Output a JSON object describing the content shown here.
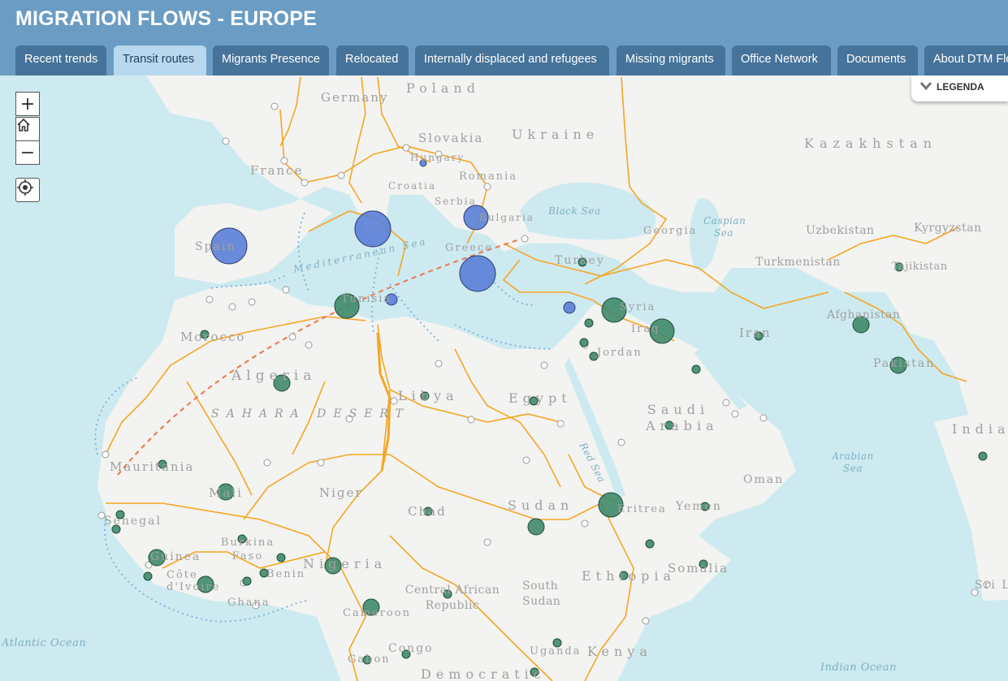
{
  "header": {
    "title": "MIGRATION FLOWS - EUROPE"
  },
  "tabs": [
    {
      "label": "Recent trends",
      "active": false
    },
    {
      "label": "Transit routes",
      "active": true
    },
    {
      "label": "Migrants Presence",
      "active": false
    },
    {
      "label": "Relocated",
      "active": false
    },
    {
      "label": "Internally displaced and refugees",
      "active": false
    },
    {
      "label": "Missing migrants",
      "active": false
    },
    {
      "label": "Office Network",
      "active": false
    },
    {
      "label": "Documents",
      "active": false
    },
    {
      "label": "About DTM Flow Monitoring",
      "active": false
    }
  ],
  "controls": {
    "zoom_in": "+",
    "zoom_out": "−",
    "home_icon": "home-icon",
    "locate_icon": "locate-icon"
  },
  "legend": {
    "label": "LEGENDA",
    "icon": "chevron-down-icon"
  },
  "colors": {
    "header": "#6a9cc4",
    "tab": "#46739a",
    "tab_active": "#b7d8ee",
    "route": "#f5a623",
    "route_dashed": "#e8805a",
    "sea_route": "#7cb2e0",
    "circle_blue": "#5b7fd6",
    "circle_green": "#3f8a6a",
    "water": "#cdeaf0",
    "land": "#f3f3f1"
  },
  "labels": {
    "countries": [
      "Poland",
      "Germany",
      "Slovakia",
      "Ukraine",
      "Kazakhstan",
      "France",
      "Hungary",
      "Romania",
      "Croatia",
      "Serbia",
      "Bulgaria",
      "Georgia",
      "Uzbekistan",
      "Kyrgyzstan",
      "Spain",
      "Greece",
      "Turkey",
      "Turkmenistan",
      "Tajikistan",
      "Morocco",
      "Tunisia",
      "Syria",
      "Iraq",
      "Iran",
      "Afghanistan",
      "Pakistan",
      "Algeria",
      "Libya",
      "Egypt",
      "Jordan",
      "Saudi Arabia",
      "India",
      "Mauritania",
      "Mali",
      "Niger",
      "Chad",
      "Sudan",
      "Eritrea",
      "Yemen",
      "Oman",
      "Senegal",
      "Guinea",
      "Burkina Faso",
      "Benin",
      "Côte d'Ivoire",
      "Ghana",
      "Nigeria",
      "Central African Republic",
      "South Sudan",
      "Ethiopia",
      "Somalia",
      "Cameroon",
      "Congo",
      "Gabon",
      "Uganda",
      "Kenya",
      "Democratic",
      "Sri Lanka"
    ],
    "seas": [
      "Black Sea",
      "Caspian Sea",
      "Mediterranean Sea",
      "Red Sea",
      "Arabian Sea",
      "Atlantic Ocean",
      "Indian Ocean"
    ],
    "region": "SAHARA DESERT"
  }
}
